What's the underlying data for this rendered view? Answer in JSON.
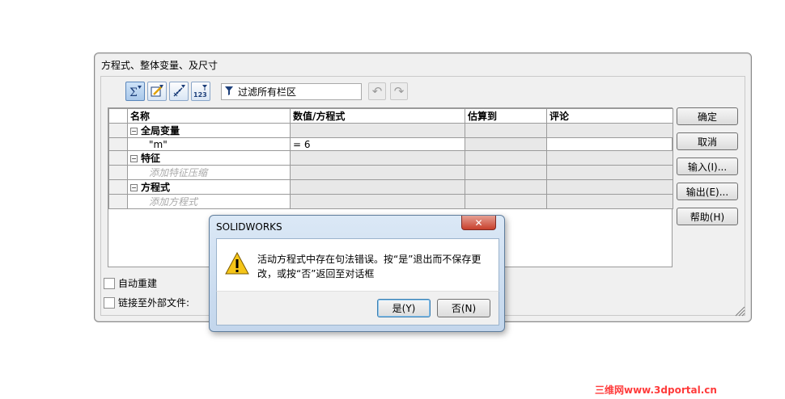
{
  "dialog": {
    "title": "方程式、整体变量、及尺寸",
    "filter_text": "过滤所有栏区",
    "toolbar_icons": [
      "equation-view-icon",
      "sketch-equation-icon",
      "dimension-view-icon",
      "ordered-view-icon"
    ],
    "table": {
      "headers": [
        "名称",
        "数值/方程式",
        "估算到",
        "评论"
      ],
      "sections": [
        {
          "label": "全局变量",
          "rows": [
            {
              "name": "\"m\"",
              "value": "= 6"
            }
          ]
        },
        {
          "label": "特征",
          "hint": "添加特征压缩"
        },
        {
          "label": "方程式",
          "hint": "添加方程式"
        }
      ]
    },
    "buttons": {
      "ok": "确定",
      "cancel": "取消",
      "import": "输入(I)...",
      "export": "输出(E)...",
      "help": "帮助(H)"
    },
    "options": {
      "auto_rebuild": "自动重建",
      "link_external": "链接至外部文件:"
    }
  },
  "message_box": {
    "title": "SOLIDWORKS",
    "close": "✕",
    "text_line1": "活动方程式中存在句法错误。按“是”退出而不保存更",
    "text_line2": "改，或按“否”返回至对话框",
    "yes": "是(Y)",
    "no": "否(N)"
  },
  "watermark": "三维网www.3dportal.cn"
}
